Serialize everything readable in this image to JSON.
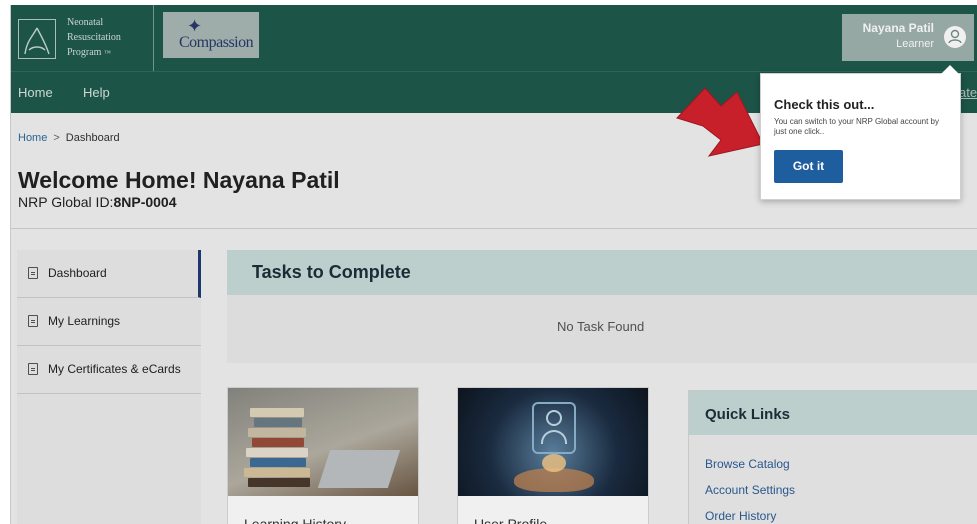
{
  "header": {
    "nrp_logo_line1": "Neonatal",
    "nrp_logo_line2": "Resuscitation",
    "nrp_logo_line3": "Program",
    "nrp_logo_tm": "™",
    "partner_logo": "Compassion",
    "user_name": "Nayana Patil",
    "user_role": "Learner"
  },
  "nav": {
    "home": "Home",
    "help": "Help",
    "edge_text": "ate"
  },
  "breadcrumb": {
    "home": "Home",
    "separator": ">",
    "current": "Dashboard"
  },
  "welcome": {
    "title": "Welcome Home! Nayana Patil",
    "id_label": "NRP Global ID:",
    "id_value": "8NP-0004"
  },
  "sidebar": {
    "items": [
      {
        "label": "Dashboard",
        "icon": "document-icon"
      },
      {
        "label": "My Learnings",
        "icon": "document-icon"
      },
      {
        "label": "My Certificates & eCards",
        "icon": "document-icon"
      }
    ]
  },
  "tasks": {
    "title": "Tasks to Complete",
    "empty": "No Task Found"
  },
  "cards": [
    {
      "title": "Learning History"
    },
    {
      "title": "User Profile"
    }
  ],
  "quick_links": {
    "title": "Quick Links",
    "items": [
      "Browse Catalog",
      "Account Settings",
      "Order History"
    ]
  },
  "popover": {
    "title": "Check this out...",
    "body": "You can switch to your NRP Global account by just one click..",
    "button": "Got it"
  },
  "colors": {
    "header_bg": "#1e5a4d",
    "accent_blue": "#1f5e9e",
    "panel_head": "#c8dcda",
    "arrow_red": "#c8202a"
  }
}
